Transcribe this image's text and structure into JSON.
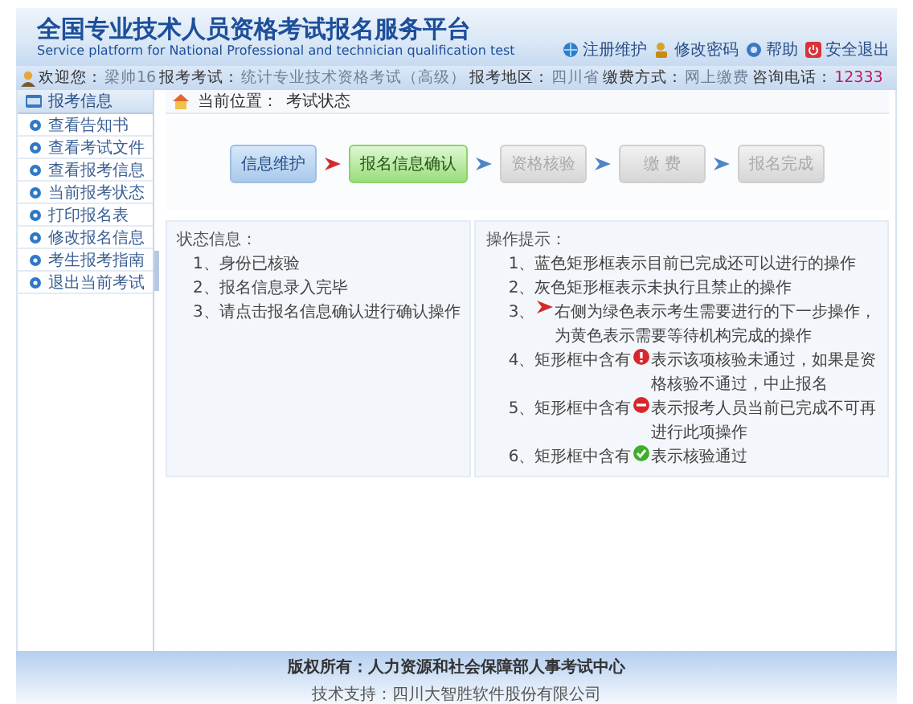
{
  "header": {
    "title": "全国专业技术人员资格考试报名服务平台",
    "subtitle": "Service platform for National Professional and technician qualification test",
    "links": [
      "注册维护",
      "修改密码",
      "帮助",
      "安全退出"
    ]
  },
  "info_bar": [
    {
      "label": "欢迎您：",
      "value": "梁帅16"
    },
    {
      "label": "报考考试：",
      "value": "统计专业技术资格考试（高级）"
    },
    {
      "label": "报考地区：",
      "value": "四川省"
    },
    {
      "label": "缴费方式：",
      "value": "网上缴费"
    },
    {
      "label": "咨询电话：",
      "value": "12333"
    }
  ],
  "sidebar": {
    "title": "报考信息",
    "items": [
      "查看告知书",
      "查看考试文件",
      "查看报考信息",
      "当前报考状态",
      "打印报名表",
      "修改报名信息",
      "考生报考指南",
      "退出当前考试"
    ]
  },
  "breadcrumb": {
    "label": "当前位置：",
    "value": "考试状态"
  },
  "steps": [
    {
      "label": "信息维护",
      "kind": "done"
    },
    {
      "label": "报名信息确认",
      "kind": "current"
    },
    {
      "label": "资格核验",
      "kind": "pending"
    },
    {
      "label": "缴 费",
      "kind": "pending"
    },
    {
      "label": "报名完成",
      "kind": "pending"
    }
  ],
  "status": {
    "title": "状态信息：",
    "items": [
      "1、身份已核验",
      "2、报名信息录入完毕",
      "3、请点击报名信息确认进行确认操作"
    ]
  },
  "tips": {
    "title": "操作提示：",
    "items": [
      {
        "kind": "plain",
        "before": "1、蓝色矩形框表示目前已完成还可以进行的操作"
      },
      {
        "kind": "plain",
        "before": "2、灰色矩形框表示未执行且禁止的操作"
      },
      {
        "kind": "arrow",
        "before": "3、",
        "after": "右侧为绿色表示考生需要进行的下一步操作，为黄色表示需要等待机构完成的操作"
      },
      {
        "kind": "warn",
        "before": "4、矩形框中含有",
        "after": "表示该项核验未通过，如果是资格核验不通过，中止报名"
      },
      {
        "kind": "stop",
        "before": "5、矩形框中含有",
        "after": "表示报考人员当前已完成不可再进行此项操作"
      },
      {
        "kind": "ok",
        "before": "6、矩形框中含有",
        "after": "表示核验通过"
      }
    ]
  },
  "footer": {
    "copyright": "版权所有：人力资源和社会保障部人事考试中心",
    "support": "技术支持：四川大智胜软件股份有限公司"
  }
}
